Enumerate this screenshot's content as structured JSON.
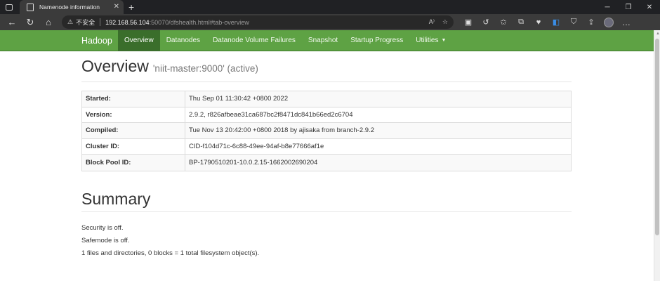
{
  "browser": {
    "tab_title": "Namenode information",
    "address": {
      "security_label": "不安全",
      "host": "192.168.56.104",
      "rest": ":50070/dfshealth.html#tab-overview"
    }
  },
  "navbar": {
    "brand": "Hadoop",
    "items": [
      {
        "label": "Overview"
      },
      {
        "label": "Datanodes"
      },
      {
        "label": "Datanode Volume Failures"
      },
      {
        "label": "Snapshot"
      },
      {
        "label": "Startup Progress"
      },
      {
        "label": "Utilities"
      }
    ]
  },
  "overview": {
    "title": "Overview",
    "subtitle": "'niit-master:9000' (active)",
    "rows": [
      {
        "key": "Started:",
        "value": "Thu Sep 01 11:30:42 +0800 2022"
      },
      {
        "key": "Version:",
        "value": "2.9.2, r826afbeae31ca687bc2f8471dc841b66ed2c6704"
      },
      {
        "key": "Compiled:",
        "value": "Tue Nov 13 20:42:00 +0800 2018 by ajisaka from branch-2.9.2"
      },
      {
        "key": "Cluster ID:",
        "value": "CID-f104d71c-6c88-49ee-94af-b8e77666af1e"
      },
      {
        "key": "Block Pool ID:",
        "value": "BP-1790510201-10.0.2.15-1662002690204"
      }
    ]
  },
  "summary": {
    "title": "Summary",
    "lines": [
      "Security is off.",
      "Safemode is off.",
      "1 files and directories, 0 blocks = 1 total filesystem object(s)."
    ]
  },
  "colors": {
    "navbar_bg": "#5ea244",
    "navbar_active": "#3a6e2b"
  }
}
